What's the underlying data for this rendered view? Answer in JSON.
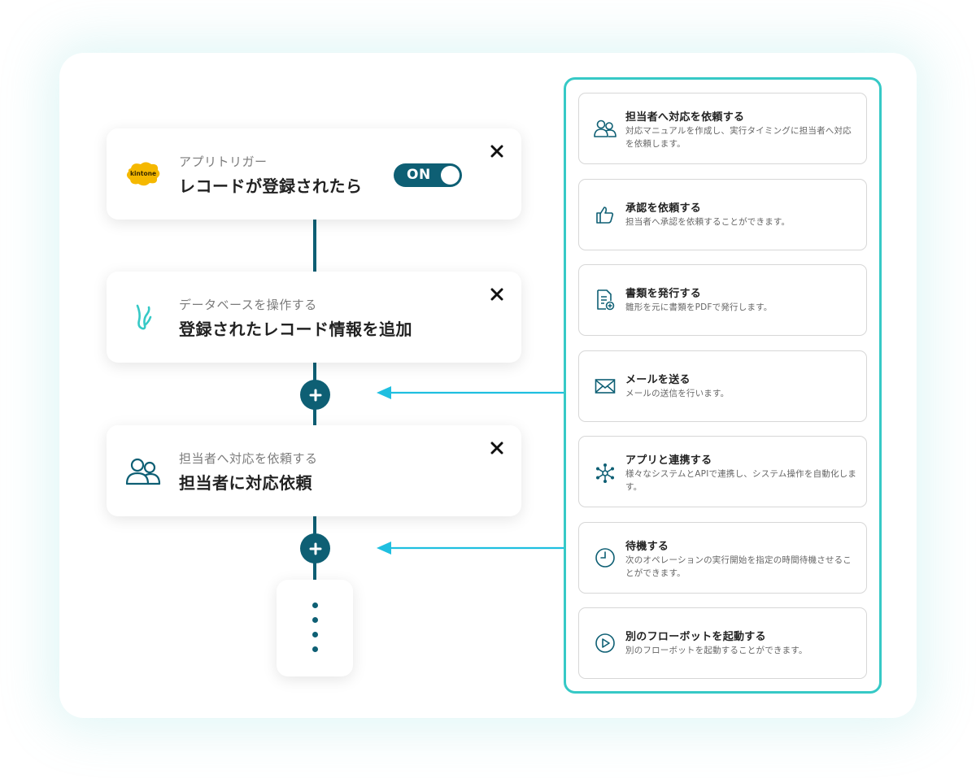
{
  "flow": {
    "trigger": {
      "logo_text": "kintone",
      "subtitle": "アプリトリガー",
      "title": "レコードが登録されたら",
      "toggle_label": "ON",
      "close_icon": "close-icon"
    },
    "steps": [
      {
        "icon": "database-operation-icon",
        "subtitle": "データベースを操作する",
        "title": "登録されたレコード情報を追加"
      },
      {
        "icon": "people-icon",
        "subtitle": "担当者へ対応を依頼する",
        "title": "担当者に対応依頼"
      }
    ],
    "add_button_icon": "plus-icon",
    "more_icon": "vertical-ellipsis-icon"
  },
  "actions": [
    {
      "icon": "people-icon",
      "title": "担当者へ対応を依頼する",
      "desc": "対応マニュアルを作成し、実行タイミングに担当者へ対応を依頼します。"
    },
    {
      "icon": "thumbs-up-icon",
      "title": "承認を依頼する",
      "desc": "担当者へ承認を依頼することができます。"
    },
    {
      "icon": "document-add-icon",
      "title": "書類を発行する",
      "desc": "雛形を元に書類をPDFで発行します。"
    },
    {
      "icon": "mail-icon",
      "title": "メールを送る",
      "desc": "メールの送信を行います。"
    },
    {
      "icon": "network-icon",
      "title": "アプリと連携する",
      "desc": "様々なシステムとAPIで連携し、システム操作を自動化します。"
    },
    {
      "icon": "clock-icon",
      "title": "待機する",
      "desc": "次のオペレーションの実行開始を指定の時間待機させることができます。"
    },
    {
      "icon": "play-circle-icon",
      "title": "別のフローボットを起動する",
      "desc": "別のフローボットを起動することができます。"
    }
  ],
  "colors": {
    "primary": "#0e5f74",
    "accent": "#36c9c6",
    "arrow": "#1fbfe0",
    "kintone": "#f5b800"
  }
}
